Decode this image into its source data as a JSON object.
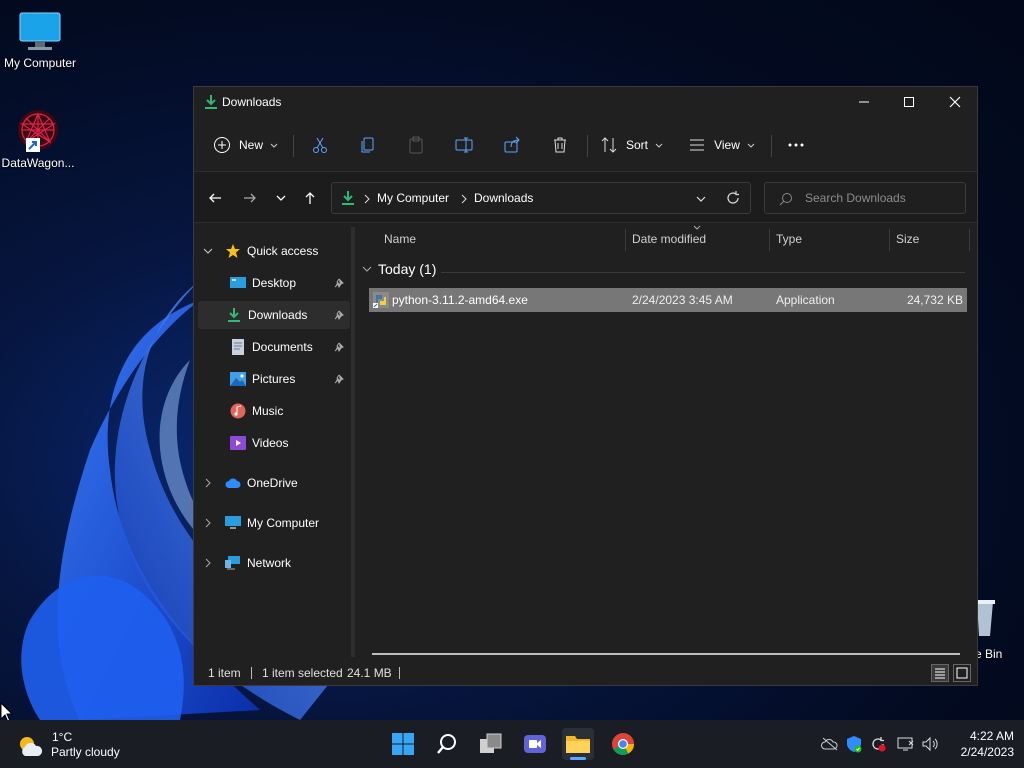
{
  "desktop": {
    "icons": [
      {
        "label": "My Computer"
      },
      {
        "label": "DataWagon..."
      }
    ],
    "recycle_label": "e Bin"
  },
  "window": {
    "title": "Downloads",
    "toolbar": {
      "new_label": "New",
      "sort_label": "Sort",
      "view_label": "View"
    },
    "address": {
      "crumbs": [
        "My Computer",
        "Downloads"
      ]
    },
    "search": {
      "placeholder": "Search Downloads"
    },
    "sidebar": {
      "quick_access": "Quick access",
      "items": [
        {
          "label": "Desktop",
          "pinned": true
        },
        {
          "label": "Downloads",
          "pinned": true
        },
        {
          "label": "Documents",
          "pinned": true
        },
        {
          "label": "Pictures",
          "pinned": true
        },
        {
          "label": "Music",
          "pinned": false
        },
        {
          "label": "Videos",
          "pinned": false
        }
      ],
      "roots": [
        {
          "label": "OneDrive"
        },
        {
          "label": "My Computer"
        },
        {
          "label": "Network"
        }
      ]
    },
    "columns": [
      "Name",
      "Date modified",
      "Type",
      "Size"
    ],
    "group": {
      "label": "Today (1)"
    },
    "files": [
      {
        "name": "python-3.11.2-amd64.exe",
        "date": "2/24/2023 3:45 AM",
        "type": "Application",
        "size": "24,732 KB"
      }
    ],
    "status": {
      "count": "1 item",
      "selected": "1 item selected",
      "size": "24.1 MB"
    }
  },
  "taskbar": {
    "weather": {
      "temp": "1°C",
      "desc": "Partly cloudy"
    },
    "clock": {
      "time": "4:22 AM",
      "date": "2/24/2023"
    }
  },
  "colors": {
    "accent": "#2f8bff",
    "window_bg": "#202020",
    "selection": "#777777",
    "downloads_green": "#2fb876"
  }
}
